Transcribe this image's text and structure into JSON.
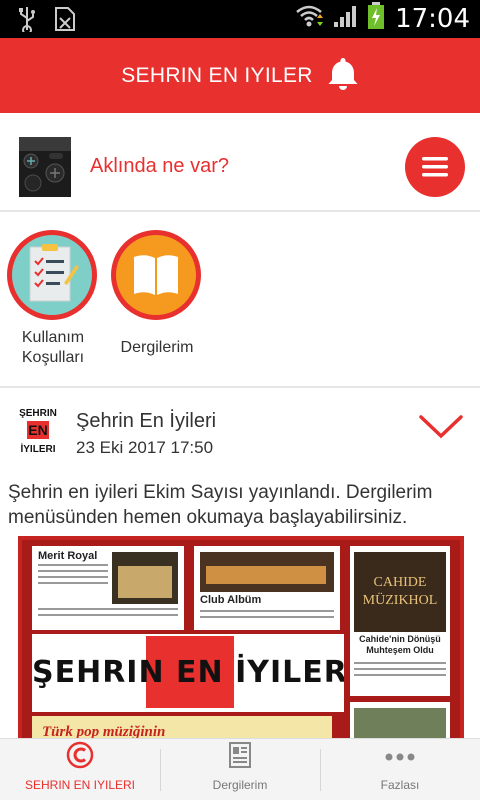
{
  "status_bar": {
    "time": "17:04"
  },
  "app_bar": {
    "title": "SEHRIN EN IYILER"
  },
  "composer": {
    "prompt": "Aklında ne var?"
  },
  "shortcuts": [
    {
      "label_line1": "Kullanım",
      "label_line2": "Koşulları"
    },
    {
      "label_line1": "Dergilerim",
      "label_line2": ""
    }
  ],
  "post": {
    "author": "Şehrin En İyileri",
    "date": "23 Eki 2017 17:50",
    "text": "Şehrin en iyileri Ekim Sayısı yayınlandı. Dergilerim menüsünden hemen okumaya başlayabilirsiniz.",
    "magazine": {
      "card1_title": "Merit Royal",
      "card2_title": "Club Albüm",
      "card3_title": "Cahide'nin Dönüşü Muhteşem Oldu",
      "masthead": "ŞEHRIN EN İYILERI",
      "strip_text": "Türk pop müziğinin"
    }
  },
  "bottom_nav": [
    {
      "label": "SEHRIN EN IYILERI",
      "active": true
    },
    {
      "label": "Dergilerim",
      "active": false
    },
    {
      "label": "Fazlası",
      "active": false
    }
  ],
  "colors": {
    "brand": "#e8302e",
    "status_bar": "#000000",
    "text": "#333333"
  }
}
